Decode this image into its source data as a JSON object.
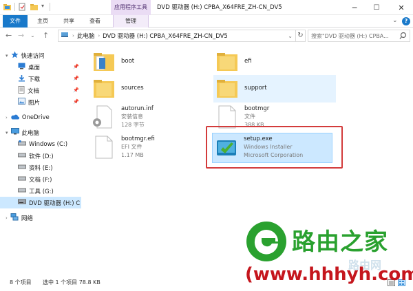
{
  "window": {
    "title": "DVD 驱动器 (H:) CPBA_X64FRE_ZH-CN_DV5",
    "context_group": "应用程序工具",
    "buttons": {
      "minimize": "─",
      "maximize": "☐",
      "close": "✕"
    }
  },
  "ribbon": {
    "tabs": [
      {
        "label": "文件"
      },
      {
        "label": "主页"
      },
      {
        "label": "共享"
      },
      {
        "label": "查看"
      },
      {
        "label": "管理"
      }
    ],
    "expand_glyph": "⌄",
    "help_glyph": "?"
  },
  "address": {
    "breadcrumb": [
      "此电脑",
      "DVD 驱动器 (H:) CPBA_X64FRE_ZH-CN_DV5"
    ],
    "separator": "›",
    "dropdown_glyph": "⌄",
    "refresh_glyph": "↻",
    "search_placeholder": "搜索\"DVD 驱动器 (H:) CPBA..."
  },
  "nav_buttons": {
    "back": "←",
    "forward": "→",
    "recent": "⌄",
    "up": "↑"
  },
  "sidebar": {
    "items": [
      {
        "label": "快速访问",
        "icon": "star-icon",
        "pinned": false
      },
      {
        "label": "桌面",
        "icon": "desktop-icon",
        "pinned": true
      },
      {
        "label": "下载",
        "icon": "download-icon",
        "pinned": true
      },
      {
        "label": "文档",
        "icon": "document-icon",
        "pinned": true
      },
      {
        "label": "图片",
        "icon": "picture-icon",
        "pinned": true
      },
      {
        "label": "OneDrive",
        "icon": "cloud-icon",
        "pinned": false
      },
      {
        "label": "此电脑",
        "icon": "computer-icon",
        "pinned": false
      },
      {
        "label": "Windows (C:)",
        "icon": "drive-icon",
        "pinned": false
      },
      {
        "label": "软件 (D:)",
        "icon": "drive-icon",
        "pinned": false
      },
      {
        "label": "资料 (E:)",
        "icon": "drive-icon",
        "pinned": false
      },
      {
        "label": "文档 (F:)",
        "icon": "drive-icon",
        "pinned": false
      },
      {
        "label": "工具 (G:)",
        "icon": "drive-icon",
        "pinned": false
      },
      {
        "label": "DVD 驱动器 (H:) C",
        "icon": "dvd-icon",
        "pinned": false,
        "selected": true
      },
      {
        "label": "网络",
        "icon": "network-icon",
        "pinned": false
      }
    ],
    "pin_glyph": "📌"
  },
  "files": [
    {
      "name": "boot",
      "kind": "folder",
      "icon": "folder-icon"
    },
    {
      "name": "efi",
      "kind": "folder",
      "icon": "folder-icon"
    },
    {
      "name": "sources",
      "kind": "folder",
      "icon": "folder-icon"
    },
    {
      "name": "support",
      "kind": "folder",
      "icon": "folder-icon",
      "hover": true
    },
    {
      "name": "autorun.inf",
      "kind": "file",
      "type": "安装信息",
      "size": "128 字节",
      "icon": "gear-file-icon"
    },
    {
      "name": "bootmgr",
      "kind": "file",
      "type": "文件",
      "size": "388 KB",
      "icon": "blank-file-icon"
    },
    {
      "name": "bootmgr.efi",
      "kind": "file",
      "type": "EFI 文件",
      "size": "1.17 MB",
      "icon": "blank-file-icon"
    },
    {
      "name": "setup.exe",
      "kind": "file",
      "type": "Windows Installer",
      "size": "Microsoft Corporation",
      "icon": "setup-icon",
      "selected": true
    }
  ],
  "status": {
    "item_count": "8 个项目",
    "selection": "选中 1 个项目  78.8 KB"
  },
  "watermark": {
    "brand": "路由之家",
    "url": "(www.hhhyh.com)",
    "ghost": "路由网"
  },
  "colors": {
    "accent": "#1979ca",
    "selection": "#cce8ff",
    "context_tab": "#eadcf4",
    "highlight_box": "#d33b3b",
    "folder": "#f5c955",
    "watermark_green": "#2aa12f",
    "watermark_red": "#c5161d"
  }
}
